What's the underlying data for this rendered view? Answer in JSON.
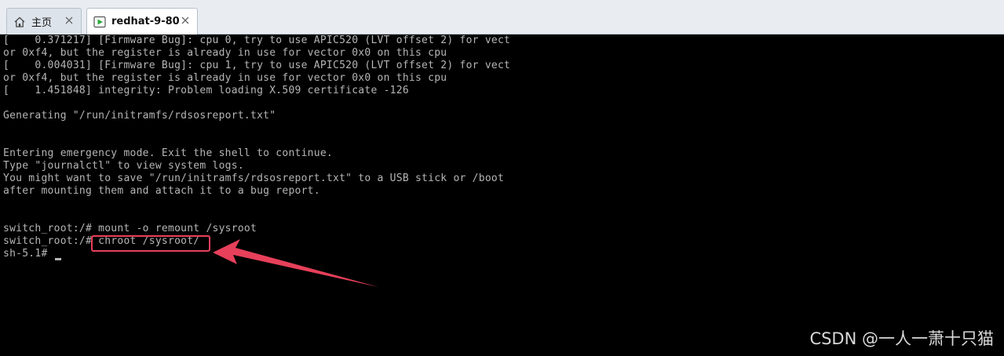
{
  "tabs": [
    {
      "label": "主页",
      "icon": "home-icon",
      "active": false
    },
    {
      "label": "redhat-9-80",
      "icon": "vm-icon",
      "active": true
    }
  ],
  "terminal": {
    "lines": [
      "[    0.371217] [Firmware Bug]: cpu 0, try to use APIC520 (LVT offset 2) for vect",
      "or 0xf4, but the register is already in use for vector 0x0 on this cpu",
      "[    0.004031] [Firmware Bug]: cpu 1, try to use APIC520 (LVT offset 2) for vect",
      "or 0xf4, but the register is already in use for vector 0x0 on this cpu",
      "[    1.451848] integrity: Problem loading X.509 certificate -126",
      "",
      "Generating \"/run/initramfs/rdsosreport.txt\"",
      "",
      "",
      "Entering emergency mode. Exit the shell to continue.",
      "Type \"journalctl\" to view system logs.",
      "You might want to save \"/run/initramfs/rdsosreport.txt\" to a USB stick or /boot",
      "after mounting them and attach it to a bug report.",
      "",
      "",
      "switch_root:/# mount -o remount /sysroot",
      "switch_root:/# chroot /sysroot/",
      "sh-5.1# "
    ],
    "text_color": "#b5b5b5",
    "background": "#000000"
  },
  "annotation": {
    "color": "#e7405a"
  },
  "watermark": {
    "text": "CSDN @一人一萧十只猫"
  }
}
